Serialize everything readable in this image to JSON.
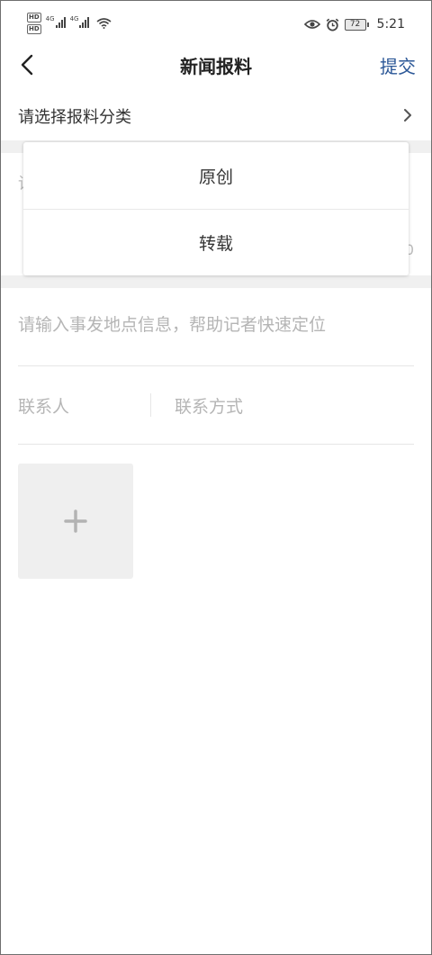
{
  "status_bar": {
    "hd_label": "HD",
    "network_label": "4G",
    "battery": "72",
    "time": "5:21",
    "icons": [
      "hd-icon",
      "signal-icon",
      "wifi-icon",
      "eye-icon",
      "alarm-icon",
      "battery-icon"
    ]
  },
  "nav": {
    "title": "新闻报料",
    "submit_label": "提交",
    "back_icon": "chevron-left-icon"
  },
  "category": {
    "label": "请选择报料分类",
    "icon": "chevron-right-icon"
  },
  "dropdown": {
    "options": [
      {
        "label": "原创"
      },
      {
        "label": "转载"
      }
    ]
  },
  "form": {
    "partial_title_char": "请",
    "partial_count_char": "0",
    "location_placeholder": "请输入事发地点信息，帮助记者快速定位",
    "contact_name_placeholder": "联系人",
    "contact_method_placeholder": "联系方式",
    "add_media_icon": "plus-icon"
  },
  "colors": {
    "accent": "#2b5797",
    "placeholder": "#b5b5b5",
    "band": "#f0f0f0"
  }
}
